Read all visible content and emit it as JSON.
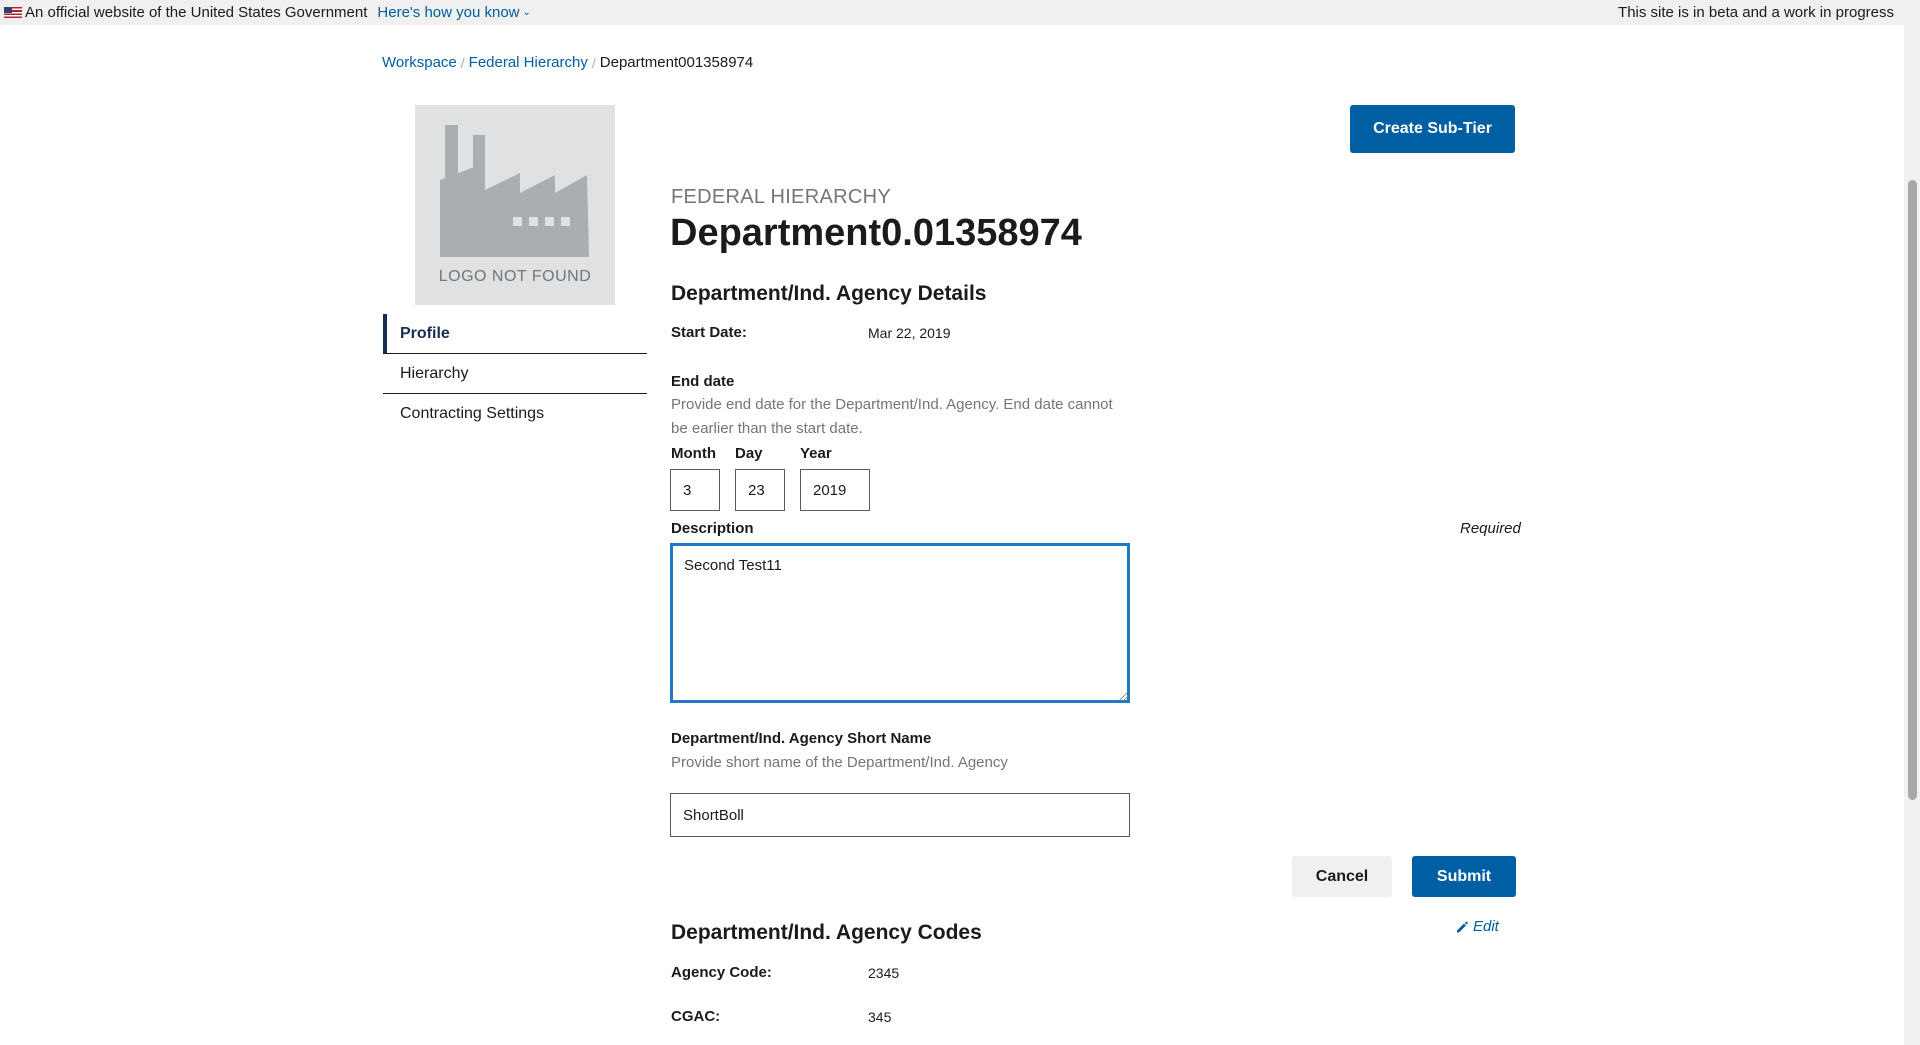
{
  "banner": {
    "official_text": "An official website of the United States Government",
    "how_you_know": "Here's how you know",
    "beta_text": "This site is in beta and a work in progress"
  },
  "breadcrumb": {
    "items": [
      "Workspace",
      "Federal Hierarchy"
    ],
    "current": "Department001358974",
    "separator": "/"
  },
  "logo": {
    "text": "LOGO NOT FOUND"
  },
  "sidenav": {
    "items": [
      {
        "label": "Profile",
        "active": true
      },
      {
        "label": "Hierarchy",
        "active": false
      },
      {
        "label": "Contracting Settings",
        "active": false
      }
    ]
  },
  "actions": {
    "create_sub_tier": "Create Sub-Tier",
    "cancel": "Cancel",
    "submit": "Submit",
    "edit": "Edit"
  },
  "header": {
    "eyebrow": "FEDERAL HIERARCHY",
    "title": "Department0.01358974"
  },
  "details": {
    "section_title": "Department/Ind. Agency Details",
    "start_date_label": "Start Date:",
    "start_date_value": "Mar 22, 2019",
    "end_date": {
      "label": "End date",
      "hint": "Provide end date for the Department/Ind. Agency. End date cannot be earlier than the start date.",
      "month_label": "Month",
      "day_label": "Day",
      "year_label": "Year",
      "month": "3",
      "day": "23",
      "year": "2019"
    },
    "description": {
      "label": "Description",
      "required": "Required",
      "value": "Second Test11"
    },
    "short_name": {
      "label": "Department/Ind. Agency Short Name",
      "hint": "Provide short name of the Department/Ind. Agency",
      "value": "ShortBoll"
    }
  },
  "codes": {
    "section_title": "Department/Ind. Agency Codes",
    "agency_code_label": "Agency Code:",
    "agency_code_value": "2345",
    "cgac_label": "CGAC:",
    "cgac_value": "345"
  },
  "colors": {
    "primary": "#005ea2",
    "focus": "#2378c3",
    "nav_active": "#162e51",
    "muted_text": "#71767a",
    "logo_bg": "#dfe1e2"
  }
}
